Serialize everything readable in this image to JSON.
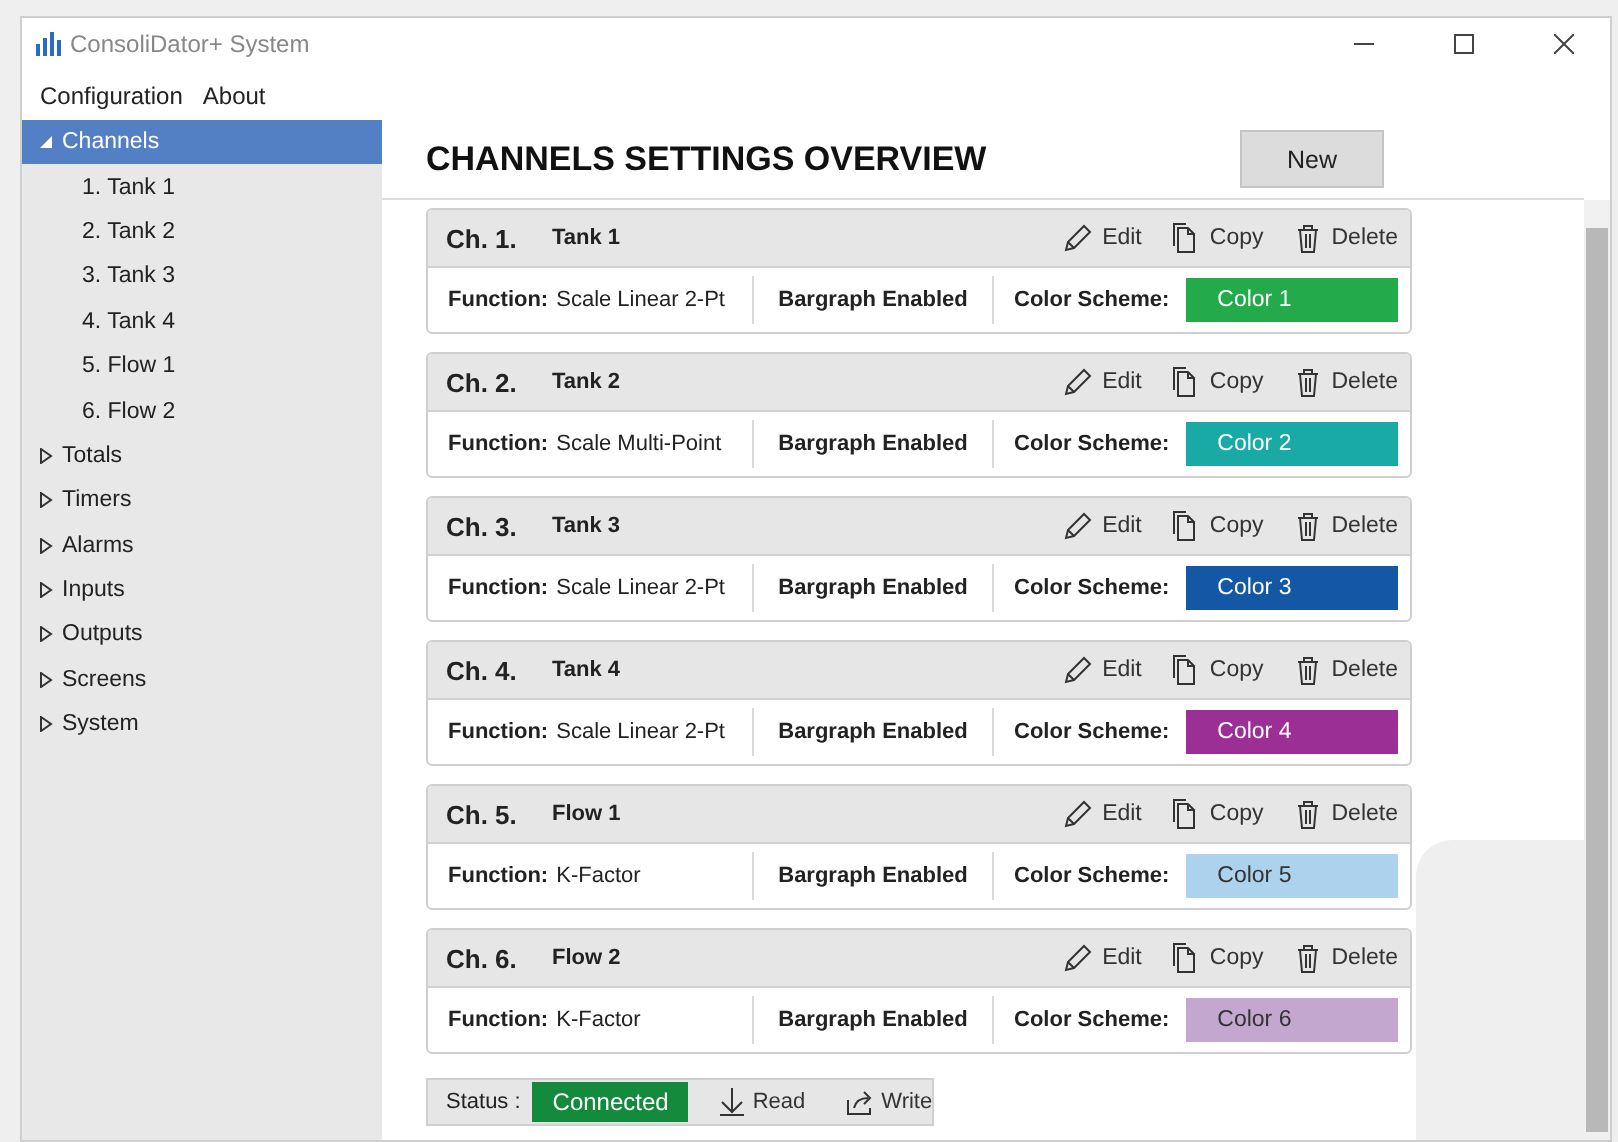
{
  "window": {
    "title": "ConsoliDator+ System"
  },
  "menu": [
    "Configuration",
    "About"
  ],
  "sidebar": {
    "items": [
      {
        "label": "Channels",
        "expanded": true,
        "selected": true,
        "children": [
          {
            "label": "1. Tank 1",
            "selected": false
          },
          {
            "label": "2. Tank 2",
            "selected": false
          },
          {
            "label": "3. Tank  3",
            "selected": false
          },
          {
            "label": "4. Tank 4",
            "selected": false
          },
          {
            "label": "5. Flow 1",
            "selected": false
          },
          {
            "label": "6. Flow 2",
            "selected": false
          }
        ]
      },
      {
        "label": "Totals",
        "expanded": false,
        "selected": false
      },
      {
        "label": "Timers",
        "expanded": false,
        "selected": false
      },
      {
        "label": "Alarms",
        "expanded": false,
        "selected": false
      },
      {
        "label": "Inputs",
        "expanded": false,
        "selected": false
      },
      {
        "label": "Outputs",
        "expanded": false,
        "selected": false
      },
      {
        "label": "Screens",
        "expanded": false,
        "selected": false
      },
      {
        "label": "System",
        "expanded": false,
        "selected": false
      }
    ]
  },
  "page": {
    "title": "CHANNELS SETTINGS OVERVIEW",
    "new_button": "New"
  },
  "channels": [
    {
      "number": "Ch. 1.",
      "name": "Tank 1",
      "actions": [
        "Edit",
        "Copy",
        "Delete"
      ],
      "function_label": "Function:",
      "function": "Scale Linear 2-Pt",
      "bargraph": "Bargraph Enabled",
      "scheme_label": "Color Scheme:",
      "scheme": "Color 1",
      "color": "#22aa4b"
    },
    {
      "number": "Ch. 2.",
      "name": "Tank 2",
      "actions": [
        "Edit",
        "Copy",
        "Delete"
      ],
      "function_label": "Function:",
      "function": "Scale Multi-Point",
      "bargraph": "Bargraph Enabled",
      "scheme_label": "Color Scheme:",
      "scheme": "Color 2",
      "color": "#1aaaa6"
    },
    {
      "number": "Ch. 3.",
      "name": "Tank  3",
      "actions": [
        "Edit",
        "Copy",
        "Delete"
      ],
      "function_label": "Function:",
      "function": "Scale Linear 2-Pt",
      "bargraph": "Bargraph Enabled",
      "scheme_label": "Color Scheme:",
      "scheme": "Color 3",
      "color": "#1457a5"
    },
    {
      "number": "Ch. 4.",
      "name": "Tank 4",
      "actions": [
        "Edit",
        "Copy",
        "Delete"
      ],
      "function_label": "Function:",
      "function": "Scale Linear 2-Pt",
      "bargraph": "Bargraph Enabled",
      "scheme_label": "Color Scheme:",
      "scheme": "Color 4",
      "color": "#9b2f95"
    },
    {
      "number": "Ch. 5.",
      "name": "Flow 1",
      "actions": [
        "Edit",
        "Copy",
        "Delete"
      ],
      "function_label": "Function:",
      "function": "K-Factor",
      "bargraph": "Bargraph Enabled",
      "scheme_label": "Color Scheme:",
      "scheme": "Color 5",
      "color": "#acd2ee"
    },
    {
      "number": "Ch. 6.",
      "name": "Flow 2",
      "actions": [
        "Edit",
        "Copy",
        "Delete"
      ],
      "function_label": "Function:",
      "function": "K-Factor",
      "bargraph": "Bargraph Enabled",
      "scheme_label": "Color Scheme:",
      "scheme": "Color 6",
      "color": "#c3a7cf"
    }
  ],
  "status_bar": {
    "label": "Status :",
    "status": "Connected",
    "read": "Read",
    "write": "Write"
  }
}
